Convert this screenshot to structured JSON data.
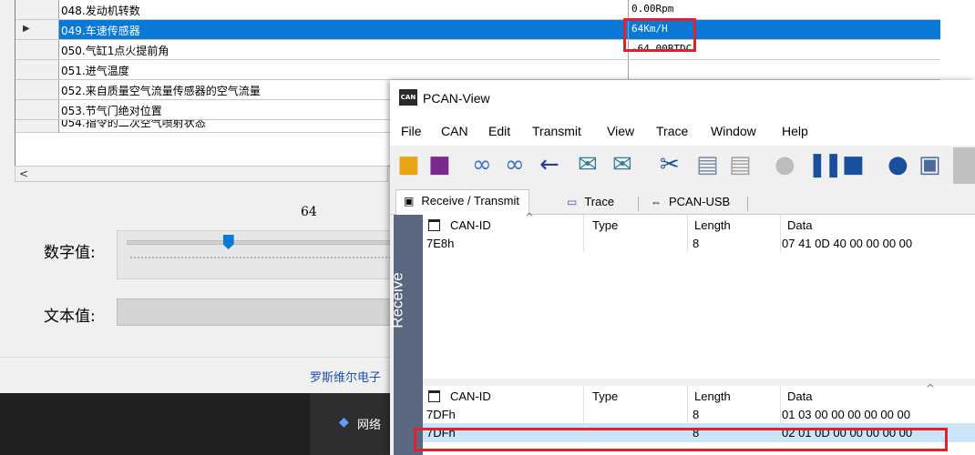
{
  "back_window": {
    "grid_rows": [
      {
        "name": "048.发动机转数",
        "value": "0.00Rpm",
        "selected": false
      },
      {
        "name": "049.车速传感器",
        "value": "64Km/H",
        "selected": true
      },
      {
        "name": "050.气缸1点火提前角",
        "value": "-64.00BTDC",
        "selected": false
      },
      {
        "name": "051.进气温度",
        "value": "",
        "selected": false
      },
      {
        "name": "052.来自质量空气流量传感器的空气流量",
        "value": "",
        "selected": false
      },
      {
        "name": "053.节气门绝对位置",
        "value": "",
        "selected": false
      },
      {
        "name": "054.指令的二次空气喷射状态",
        "value": "",
        "selected": false
      }
    ],
    "slider_value": "64",
    "slider_fraction": 0.38,
    "numeric_label": "数字值:",
    "text_label": "文本值:",
    "company": "罗斯维尔电子",
    "taskbar_network": "网络"
  },
  "pcan": {
    "title": "PCAN-View",
    "menu": [
      "File",
      "CAN",
      "Edit",
      "Transmit",
      "View",
      "Trace",
      "Window",
      "Help"
    ],
    "tabs": [
      "Receive / Transmit",
      "Trace",
      "PCAN-USB"
    ],
    "side_label": "Receive",
    "columns": [
      "CAN-ID",
      "Type",
      "Length",
      "Data"
    ],
    "receive_rows": [
      {
        "id": "7E8h",
        "type": "",
        "length": "8",
        "data": "07 41 0D 40 00 00 00 00"
      }
    ],
    "transmit_rows": [
      {
        "id": "7DFh",
        "type": "",
        "length": "8",
        "data": "01 03 00 00 00 00 00 00"
      },
      {
        "id": "7DFh",
        "type": "",
        "length": "8",
        "data": "02 01 0D 00 00 00 00 00"
      }
    ]
  },
  "colors": {
    "highlight": "#e0202a",
    "selection": "#0a78d7",
    "row_selected": "#cce4f7"
  }
}
